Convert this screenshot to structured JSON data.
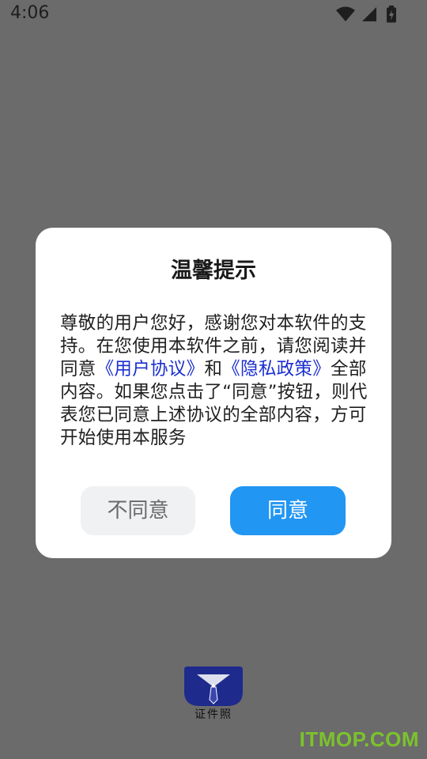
{
  "status_bar": {
    "time": "4:06",
    "icons": [
      "wifi-icon",
      "signal-icon",
      "battery-charging-icon"
    ]
  },
  "dialog": {
    "title": "温馨提示",
    "body_part1": "尊敬的用户您好，感谢您对本软件的支持。在您使用本软件之前，请您阅读并同意",
    "link_user_agreement": "《用户协议》",
    "body_and": "和",
    "link_privacy_policy": "《隐私政策》",
    "body_part2": "全部内容。如果您点击了“同意”按钮，则代表您已同意上述协议的全部内容，方可开始使用本服务",
    "disagree_label": "不同意",
    "agree_label": "同意"
  },
  "app": {
    "logo_label": "证件照"
  },
  "watermark": "ITMOP.COM",
  "colors": {
    "overlay": "#6b6b6b",
    "link": "#1a2fd0",
    "agree_button": "#2196f3",
    "disagree_button": "#f0f1f3",
    "logo_blue": "#1e2a8c",
    "watermark": "#7ed321"
  }
}
